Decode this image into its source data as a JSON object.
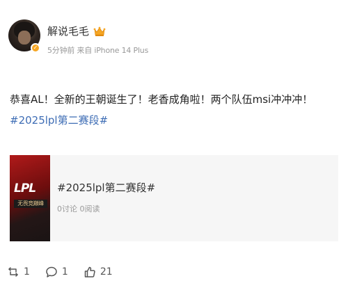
{
  "author": {
    "name": "解说毛毛",
    "badge_icon": "crown-icon",
    "verified_icon": "verified-badge-icon"
  },
  "post": {
    "meta": "5分钟前 来自 iPhone 14 Plus",
    "text_before": "恭喜AL！全新的王朝诞生了！老香成角啦！两个队伍msi冲冲冲！",
    "hashtag": "#2025lpl第二赛段#"
  },
  "topic_card": {
    "title": "#2025lpl第二赛段#",
    "stats": "0讨论 0阅读",
    "thumb_logo": "LPL",
    "thumb_tagline": "无畏竞巅峰"
  },
  "actions": {
    "repost": {
      "icon": "repost-icon",
      "count": "1"
    },
    "comment": {
      "icon": "comment-icon",
      "count": "1"
    },
    "like": {
      "icon": "thumbs-up-icon",
      "count": "21"
    }
  },
  "colors": {
    "link": "#3e6db5",
    "meta_text": "#999999",
    "card_bg": "#f6f6f6",
    "crown": "#f6a623"
  }
}
